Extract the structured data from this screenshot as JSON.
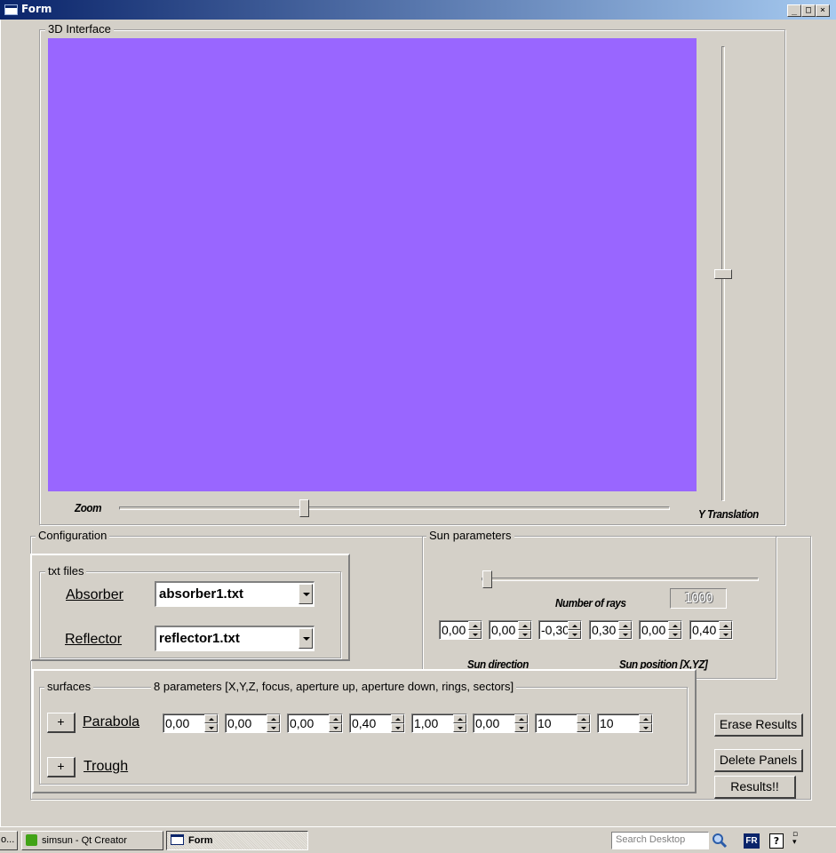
{
  "window": {
    "title": "Form"
  },
  "interface_group": {
    "title": "3D Interface",
    "zoom_label": "Zoom",
    "y_translation_label": "Y Translation",
    "viewport_color": "#9966ff"
  },
  "configuration": {
    "title": "Configuration",
    "txt_files": {
      "title": "txt files",
      "absorber_label": "Absorber",
      "absorber_value": "absorber1.txt",
      "reflector_label": "Reflector",
      "reflector_value": "reflector1.txt"
    }
  },
  "sun": {
    "title": "Sun parameters",
    "number_of_rays_label": "Number of rays",
    "number_of_rays_value": "1000",
    "spinboxes": [
      "0,00",
      "0,00",
      "-0,30",
      "0,30",
      "0,00",
      "0,40"
    ],
    "sun_direction_label": "Sun direction",
    "sun_position_label": "Sun position [X,YZ]"
  },
  "surfaces": {
    "title": "surfaces",
    "params_caption": "8 parameters [X,Y,Z, focus, aperture up, aperture down, rings, sectors]",
    "add_label": "+",
    "parabola_label": "Parabola",
    "trough_label": "Trough",
    "parabola_values": [
      "0,00",
      "0,00",
      "0,00",
      "0,40",
      "1,00",
      "0,00",
      "10",
      "10"
    ]
  },
  "buttons": {
    "erase_results": "Erase Results",
    "delete_panels": "Delete Panels",
    "results": "Results!!"
  },
  "taskbar": {
    "item0": "o...",
    "item1": "simsun - Qt Creator",
    "item2": "Form",
    "search_placeholder": "Search Desktop",
    "lang": "FR"
  }
}
